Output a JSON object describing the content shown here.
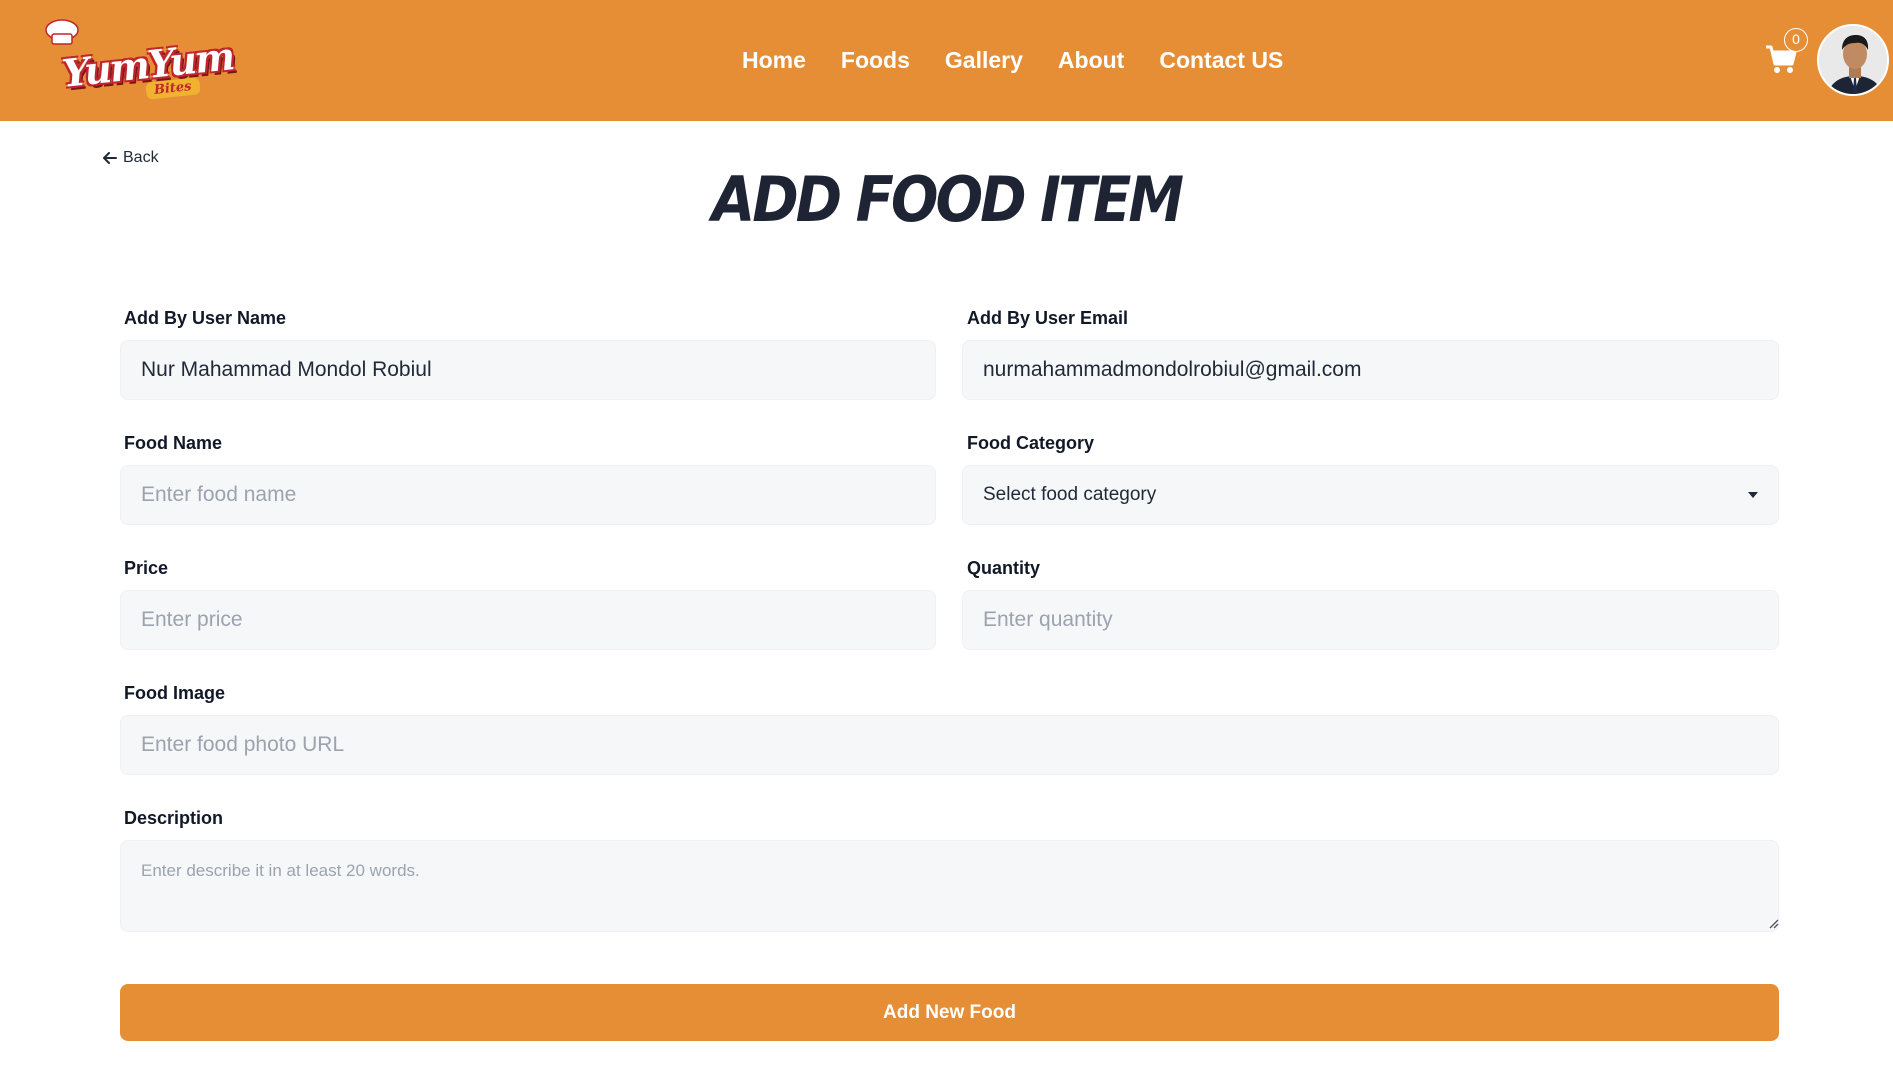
{
  "brand": {
    "logo_text": "YumYum",
    "logo_sub": "Bites",
    "colors": {
      "primary": "#e68e35",
      "logo_red": "#c0262d",
      "logo_gold": "#f0b230"
    }
  },
  "nav": {
    "items": [
      "Home",
      "Foods",
      "Gallery",
      "About",
      "Contact US"
    ]
  },
  "cart": {
    "count": "0",
    "icon": "cart-icon"
  },
  "back": {
    "label": "Back",
    "icon": "arrow-left-icon"
  },
  "page": {
    "title": "ADD FOOD ITEM"
  },
  "form": {
    "user_name": {
      "label": "Add By User Name",
      "value": "Nur Mahammad Mondol Robiul"
    },
    "user_email": {
      "label": "Add By User Email",
      "value": "nurmahammadmondolrobiul@gmail.com"
    },
    "food_name": {
      "label": "Food Name",
      "placeholder": "Enter food name"
    },
    "food_category": {
      "label": "Food Category",
      "selected": "Select food category"
    },
    "price": {
      "label": "Price",
      "placeholder": "Enter price"
    },
    "quantity": {
      "label": "Quantity",
      "placeholder": "Enter quantity"
    },
    "food_image": {
      "label": "Food Image",
      "placeholder": "Enter food photo URL"
    },
    "description": {
      "label": "Description",
      "placeholder": "Enter describe it in at least 20 words."
    },
    "submit_label": "Add New Food"
  }
}
